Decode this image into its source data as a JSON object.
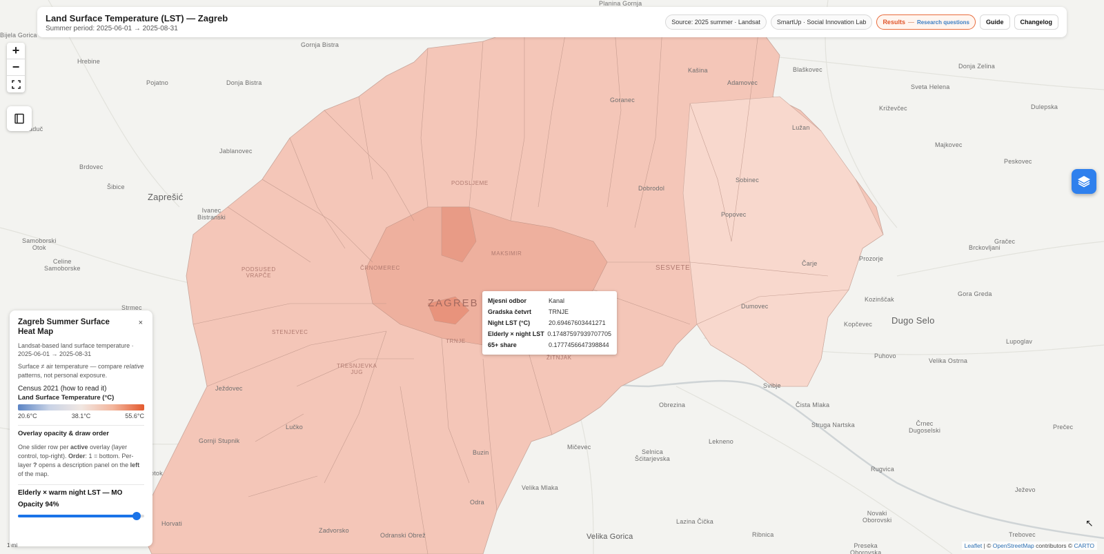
{
  "header": {
    "title": "Land Surface Temperature (LST) — Zagreb",
    "subtitle": "Summer period: 2025-06-01 → 2025-08-31",
    "chips": {
      "source": "Source: 2025 summer · Landsat",
      "lab": "SmartUp · Social Innovation Lab",
      "results": "Results",
      "results_sep": "—",
      "results_sub": "Research questions",
      "guide": "Guide",
      "changelog": "Changelog"
    }
  },
  "controls": {
    "zoom_in": "+",
    "zoom_out": "−",
    "fullscreen_icon": "fullscreen-icon",
    "book_icon": "book-icon",
    "layers_icon": "layers-icon"
  },
  "places": [
    {
      "id": "bijela-gorica",
      "label": "Bijela Gorica"
    },
    {
      "id": "gornja-bistra",
      "label": "Gornja Bistra"
    },
    {
      "id": "hrebine",
      "label": "Hrebine"
    },
    {
      "id": "pojatno",
      "label": "Pojatno"
    },
    {
      "id": "donja-bistra",
      "label": "Donja Bistra"
    },
    {
      "id": "jablanovec",
      "label": "Jablanovec"
    },
    {
      "id": "brdovec",
      "label": "Brdovec"
    },
    {
      "id": "sibice",
      "label": "Šibice"
    },
    {
      "id": "zapresic",
      "label": "Zaprešić"
    },
    {
      "id": "ivanec",
      "label": "Ivanec\nBistranski"
    },
    {
      "id": "samoborski",
      "label": "Samoborski\nOtok"
    },
    {
      "id": "celine",
      "label": "Celine\nSamoborske"
    },
    {
      "id": "strmec",
      "label": "Strmec"
    },
    {
      "id": "jezdovec",
      "label": "Ježdovec"
    },
    {
      "id": "lucko",
      "label": "Lučko"
    },
    {
      "id": "gornji-stupnik",
      "label": "Gornji Stupnik"
    },
    {
      "id": "horvati",
      "label": "Horvati"
    },
    {
      "id": "zadvorsko",
      "label": "Zadvorsko"
    },
    {
      "id": "odranski",
      "label": "Odranski Obrež"
    },
    {
      "id": "odra",
      "label": "Odra"
    },
    {
      "id": "buzin",
      "label": "Buzin"
    },
    {
      "id": "micevec",
      "label": "Mičevec"
    },
    {
      "id": "velika-mlaka",
      "label": "Velika Mlaka"
    },
    {
      "id": "velika-gorica",
      "label": "Velika Gorica"
    },
    {
      "id": "selnica",
      "label": "Selnica\nŠćitarjevska"
    },
    {
      "id": "lazina",
      "label": "Lazina Čička"
    },
    {
      "id": "ribnica",
      "label": "Ribnica"
    },
    {
      "id": "lekneno",
      "label": "Lekneno"
    },
    {
      "id": "obrezina",
      "label": "Obrezina"
    },
    {
      "id": "svibje",
      "label": "Svibje"
    },
    {
      "id": "cista-mlaka",
      "label": "Čista Mlaka"
    },
    {
      "id": "struga",
      "label": "Struga Nartska"
    },
    {
      "id": "rugvica",
      "label": "Rugvica"
    },
    {
      "id": "novaki",
      "label": "Novaki\nOborovski"
    },
    {
      "id": "preseka",
      "label": "Preseka\nOborovska"
    },
    {
      "id": "trebovec",
      "label": "Trebovec"
    },
    {
      "id": "jezevo",
      "label": "Ježevo"
    },
    {
      "id": "precec",
      "label": "Prečec"
    },
    {
      "id": "crnec",
      "label": "Črnec\nDugoselski"
    },
    {
      "id": "velika-ostrna",
      "label": "Velika Ostrna"
    },
    {
      "id": "puhovo",
      "label": "Puhovo"
    },
    {
      "id": "lupoglav",
      "label": "Lupoglav"
    },
    {
      "id": "dugo-selo",
      "label": "Dugo Selo"
    },
    {
      "id": "kopcevec",
      "label": "Kopčevec"
    },
    {
      "id": "kozincak",
      "label": "Kozinščak"
    },
    {
      "id": "gora-greda",
      "label": "Gora Greda"
    },
    {
      "id": "prozorje",
      "label": "Prozorje"
    },
    {
      "id": "brckovljani",
      "label": "Brckovljani"
    },
    {
      "id": "gracec",
      "label": "Gračec"
    },
    {
      "id": "peskovec",
      "label": "Peskovec"
    },
    {
      "id": "majkovec",
      "label": "Majkovec"
    },
    {
      "id": "krizevcec",
      "label": "Križevčec"
    },
    {
      "id": "dulepska",
      "label": "Dulepska"
    },
    {
      "id": "sveta-helena",
      "label": "Sveta Helena"
    },
    {
      "id": "donja-zelina",
      "label": "Donja Zelina"
    },
    {
      "id": "blaskovec",
      "label": "Blaškovec"
    },
    {
      "id": "planina",
      "label": "Planina Gornja"
    },
    {
      "id": "kasina",
      "label": "Kašina"
    },
    {
      "id": "adamovec",
      "label": "Adamovec"
    },
    {
      "id": "goranec",
      "label": "Goranec"
    },
    {
      "id": "luzan",
      "label": "Lužan"
    },
    {
      "id": "sobinec",
      "label": "Sobinec"
    },
    {
      "id": "popovec",
      "label": "Popovec"
    },
    {
      "id": "dobrodol",
      "label": "Dobrodol"
    },
    {
      "id": "carje",
      "label": "Čarje"
    },
    {
      "id": "dumovec",
      "label": "Dumovec"
    },
    {
      "id": "podsljeme",
      "label": "PODSLJEME"
    },
    {
      "id": "maksimir",
      "label": "MAKSIMIR"
    },
    {
      "id": "crnomerec",
      "label": "ČRNOMEREC"
    },
    {
      "id": "podsused",
      "label": "PODSUSED\nVRAPČE"
    },
    {
      "id": "stenjevec",
      "label": "STENJEVEC"
    },
    {
      "id": "novi-zagreb",
      "label": "TRESNJEVKA\nJUG"
    },
    {
      "id": "trnje",
      "label": "TRNJE"
    },
    {
      "id": "peščenica",
      "label": "ŽITNJAK"
    },
    {
      "id": "sesvete",
      "label": "SESVETE"
    },
    {
      "id": "zagreb",
      "label": "ZAGREB"
    },
    {
      "id": "raduc",
      "label": "aduč"
    },
    {
      "id": "otok",
      "label": "otok"
    }
  ],
  "tooltip": {
    "rows": [
      {
        "key": "Mjesni odbor",
        "value": "Kanal"
      },
      {
        "key": "Gradska četvrt",
        "value": "TRNJE"
      },
      {
        "key": "Night LST (°C)",
        "value": "20.69467603441271"
      },
      {
        "key": "Elderly × night LST",
        "value": "0.17487597939707705"
      },
      {
        "key": "65+ share",
        "value": "0.1777456647398844"
      }
    ]
  },
  "panel": {
    "title": "Zagreb Summer Surface Heat Map",
    "close": "×",
    "description": "Landsat-based land surface temperature · 2025-06-01 → 2025-08-31",
    "note_pre": "Surface ≠ air temperature — compare ",
    "note_em": "relative",
    "note_post": " patterns, not personal exposure.",
    "census_link": "Census 2021 (how to read it)",
    "legend_title": "Land Surface Temperature (°C)",
    "legend_colors": [
      "#5b84c4",
      "#c9d3e6",
      "#f1e7e2",
      "#f3b69d",
      "#e35a2f"
    ],
    "ticks": [
      "20.6°C",
      "38.1°C",
      "55.6°C"
    ],
    "section_title": "Overlay opacity & draw order",
    "help_1": "One slider row per ",
    "help_active": "active",
    "help_2": " overlay (layer control, top-right). ",
    "help_order": "Order",
    "help_3": ": 1 = bottom. Per-layer ",
    "help_q": "?",
    "help_4": " opens a description panel on the ",
    "help_left": "left",
    "help_5": " of the map.",
    "layer_name": "Elderly × warm night LST — MO",
    "opacity_label": "Opacity 94%",
    "opacity_value": 0.94
  },
  "attribution": {
    "leaflet": "Leaflet",
    "sep": " | © ",
    "osm": "OpenStreetMap",
    "contrib": " contributors © ",
    "carto": "CARTO"
  },
  "scale_text": "1 mi"
}
